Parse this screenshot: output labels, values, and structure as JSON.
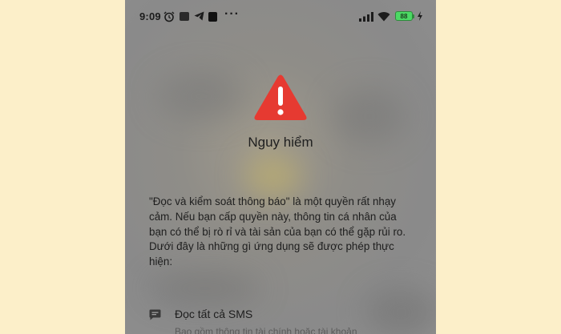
{
  "status_bar": {
    "time": "9:09",
    "overflow": "···",
    "battery_level": "88",
    "icons": [
      "alarm-icon",
      "app-icon",
      "telegram-icon",
      "tiktok-icon",
      "signal-icon",
      "wifi-icon",
      "battery-icon",
      "charge-icon"
    ]
  },
  "dialog": {
    "icon": "warning-triangle-icon",
    "icon_color": "#e63a31",
    "title": "Nguy hiểm",
    "message": "\"Đọc và kiểm soát thông báo\" là một quyền rất nhạy cảm. Nếu bạn cấp quyền này, thông tin cá nhân của bạn có thể bị rò rỉ và tài sản của bạn có thể gặp rủi ro. Dưới đây là những gì ứng dụng sẽ được phép thực hiện:",
    "permissions": [
      {
        "icon": "sms-icon",
        "title": "Đọc tất cả SMS",
        "description": "Bao gồm thông tin tài chính hoặc tài khoản"
      }
    ]
  },
  "colors": {
    "page_background": "#fcefc9",
    "screen_background": "#8c8c8c",
    "battery": "#4cd964"
  }
}
